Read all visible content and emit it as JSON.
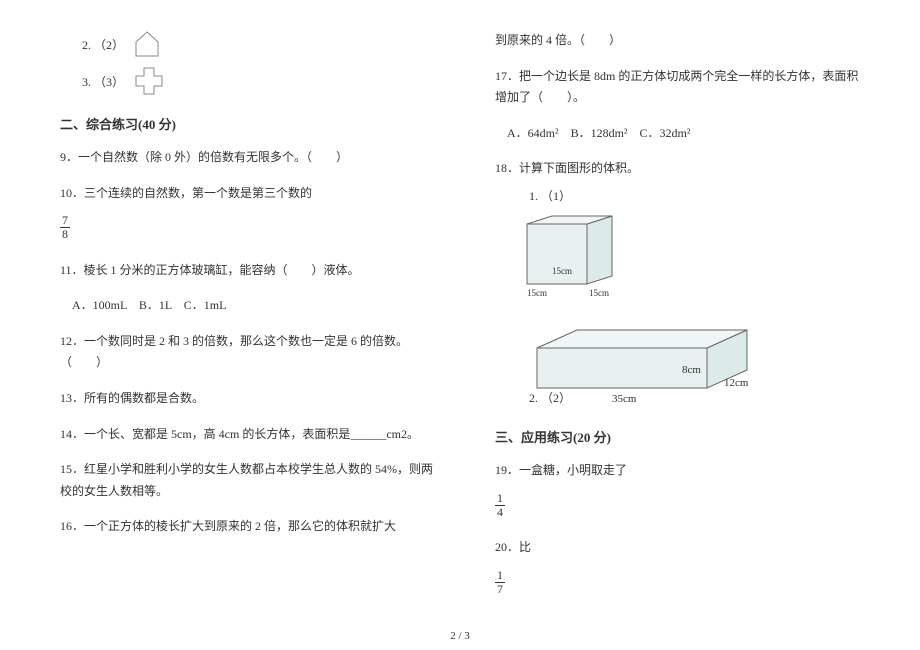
{
  "left": {
    "q2_prefix": "2. （2）",
    "q3_prefix": "3. （3）",
    "section2_title": "二、综合练习(40 分)",
    "q9": "9．一个自然数（除 0 外）的倍数有无限多个。（　　）",
    "q10": "10．三个连续的自然数，第一个数是第三个数的",
    "q10_frac_num": "7",
    "q10_frac_den": "8",
    "q11": "11．棱长 1 分米的正方体玻璃缸，能容纳（　　）液体。",
    "q11_options": "　A．100mL　B．1L　C．1mL",
    "q12": "12．一个数同时是 2 和 3 的倍数，那么这个数也一定是 6 的倍数。（　　）",
    "q13": "13．所有的偶数都是合数。",
    "q14": "14．一个长、宽都是 5cm，高 4cm 的长方体，表面积是______cm2。",
    "q15": "15．红星小学和胜利小学的女生人数都占本校学生总人数的 54%，则两校的女生人数相等。",
    "q16": "16．一个正方体的棱长扩大到原来的 2 倍，那么它的体积就扩大"
  },
  "right": {
    "q16_cont": "到原来的 4 倍。（　　）",
    "q17": "17．把一个边长是 8dm 的正方体切成两个完全一样的长方体，表面积增加了（　　）。",
    "q17_options": "　A．64dm²　B．128dm²　C．32dm²",
    "q18": "18．计算下面图形的体积。",
    "q18_1": "1. （1）",
    "q18_2": "2. （2）",
    "fig1_15cm_side": "15cm",
    "fig1_15cm_bottom": "15cm",
    "fig1_15cm_h": "15cm",
    "fig2_35cm": "35cm",
    "fig2_12cm": "12cm",
    "fig2_8cm": "8cm",
    "section3_title": "三、应用练习(20 分)",
    "q19": "19．一盒糖，小明取走了",
    "q19_frac_num": "1",
    "q19_frac_den": "4",
    "q20": "20．比",
    "q20_frac_num": "1",
    "q20_frac_den": "7"
  },
  "footer": "2 / 3"
}
